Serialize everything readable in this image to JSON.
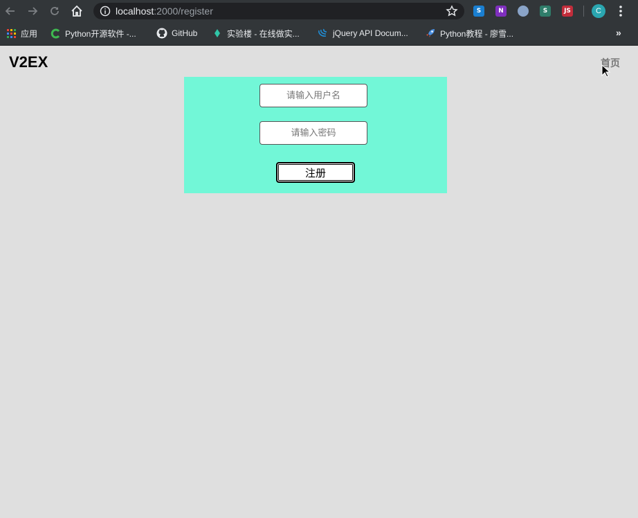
{
  "browser": {
    "url_host": "localhost",
    "url_path": ":2000/register",
    "extensions": [
      {
        "icon": "slack-like-icon",
        "label": "S",
        "color": "#1a7fd1"
      },
      {
        "icon": "onenote-icon",
        "label": "N",
        "color": "#7f2fbe"
      },
      {
        "icon": "circle-extension-icon",
        "label": "",
        "color": "#8aa4c8"
      },
      {
        "icon": "s-extension-icon",
        "label": "S",
        "color": "#2f7d6a"
      },
      {
        "icon": "js-extension-icon",
        "label": "JS",
        "color": "#c22d3b"
      }
    ],
    "avatar_letter": "C",
    "bookmarks": [
      {
        "icon": "apps-grid-icon",
        "label": "应用"
      },
      {
        "icon": "c-logo-icon",
        "label": "Python开源软件 -..."
      },
      {
        "icon": "github-icon",
        "label": "GitHub"
      },
      {
        "icon": "shiyanlou-icon",
        "label": "实验楼 - 在线做实..."
      },
      {
        "icon": "jquery-icon",
        "label": "jQuery API Docum..."
      },
      {
        "icon": "rocket-icon",
        "label": "Python教程 - 廖雪..."
      }
    ],
    "bookmarks_more": "»"
  },
  "page": {
    "logo": "V2EX",
    "nav_home": "首页",
    "form": {
      "username_placeholder": "请输入用户名",
      "password_placeholder": "请输入密码",
      "username_value": "",
      "password_value": "",
      "submit_label": "注册"
    }
  },
  "colors": {
    "page_background": "#dfdfdf",
    "panel_background": "#72f7d7",
    "browser_chrome": "#323639"
  }
}
